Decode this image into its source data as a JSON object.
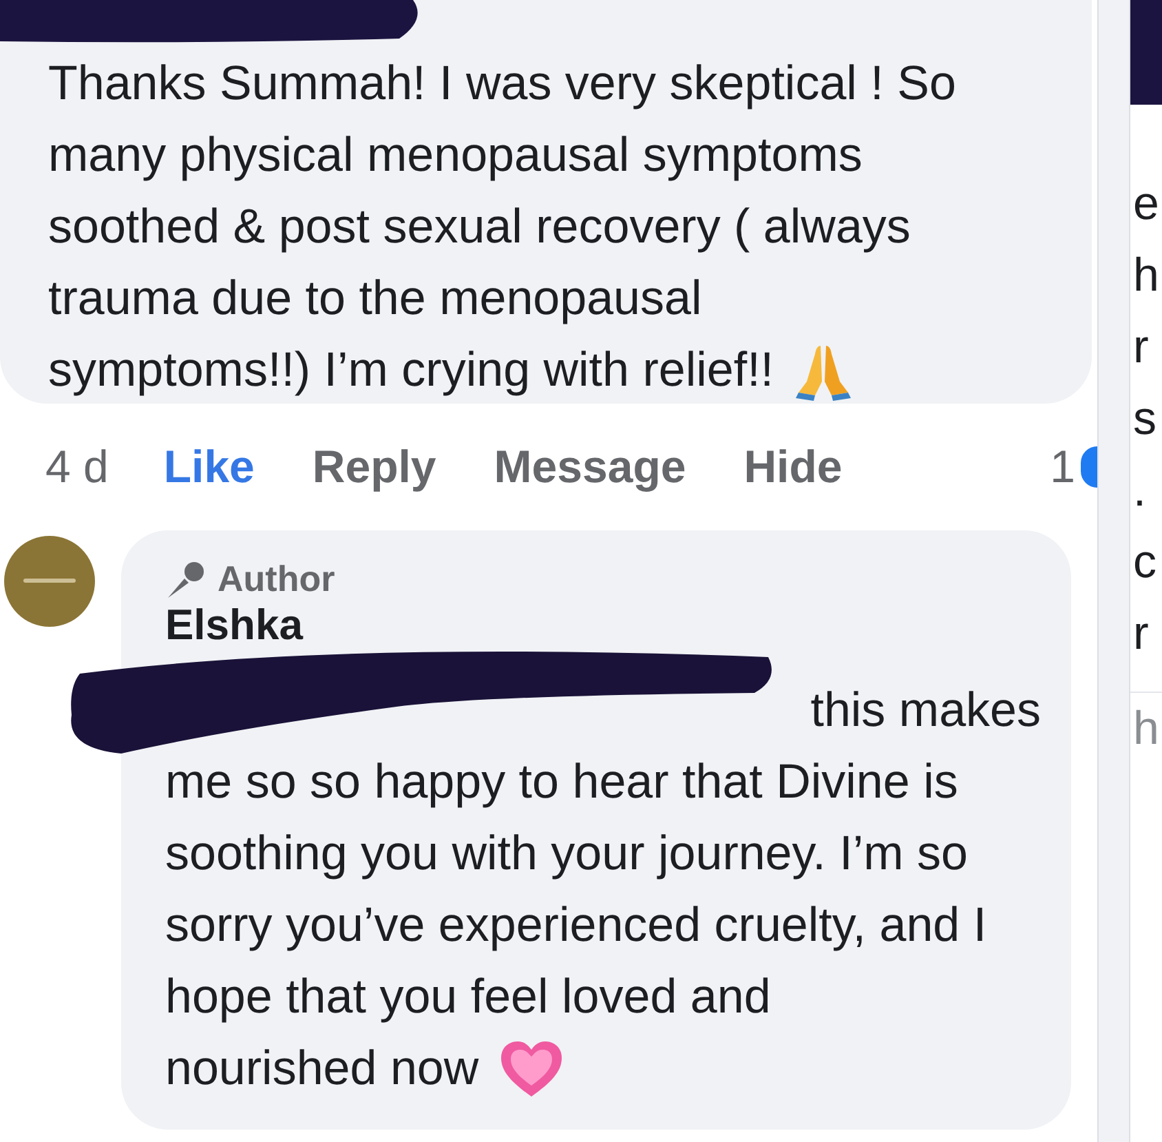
{
  "comment": {
    "lines": [
      "Thanks Summah! I was very skeptical ! So",
      "many physical menopausal symptoms",
      "soothed & post sexual recovery ( always",
      "trauma due to the menopausal",
      "symptoms!!) I’m crying with relief!!"
    ],
    "time": "4 d",
    "actions": [
      {
        "label": "Like",
        "selected": true
      },
      {
        "label": "Reply",
        "selected": false
      },
      {
        "label": "Message",
        "selected": false
      },
      {
        "label": "Hide",
        "selected": false
      }
    ],
    "reaction_count": "1"
  },
  "reply": {
    "badge": "Author",
    "author": "Elshka",
    "visible_fragment": "this makes",
    "lines": [
      "me so so happy to hear that Divine is",
      "soothing you with your journey. I’m so",
      "sorry you’ve experienced cruelty, and I",
      "hope that you feel loved and",
      "nourished now"
    ]
  },
  "side_panel": {
    "fragments": [
      "e",
      "h",
      "r",
      "s",
      ".",
      "c",
      "r"
    ],
    "footer_fragment": "h"
  }
}
